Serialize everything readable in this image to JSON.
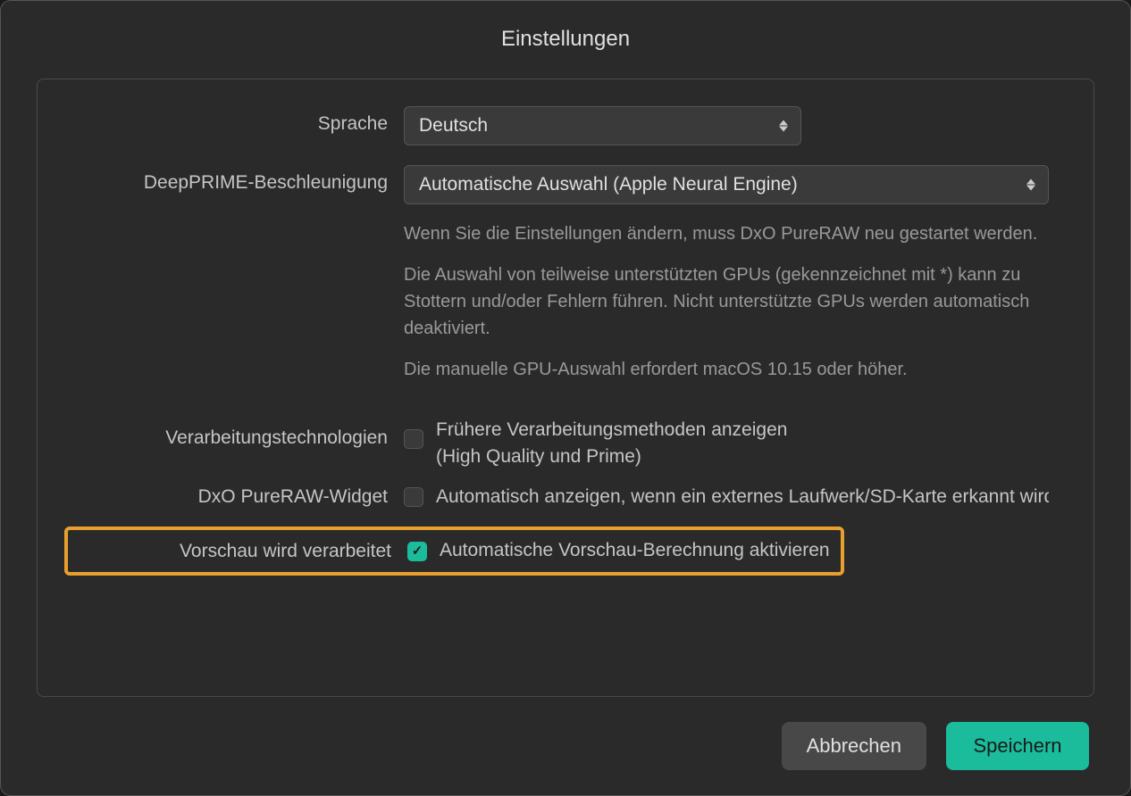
{
  "title": "Einstellungen",
  "language": {
    "label": "Sprache",
    "value": "Deutsch"
  },
  "acceleration": {
    "label": "DeepPRIME-Beschleunigung",
    "value": "Automatische Auswahl (Apple Neural Engine)",
    "help1": "Wenn Sie die Einstellungen ändern, muss DxO PureRAW neu gestartet werden.",
    "help2": "Die Auswahl von teilweise unterstützten GPUs (gekennzeichnet mit *) kann zu Stottern und/oder Fehlern führen. Nicht unterstützte GPUs werden automatisch deaktiviert.",
    "help3": "Die manuelle GPU-Auswahl erfordert macOS 10.15 oder höher."
  },
  "processing_tech": {
    "label": "Verarbeitungstechnologien",
    "checkbox_label": "Frühere Verarbeitungsmethoden anzeigen\n(High Quality und Prime)",
    "line1": "Frühere Verarbeitungsmethoden anzeigen",
    "line2": "(High Quality und Prime)"
  },
  "widget": {
    "label": "DxO PureRAW-Widget",
    "checkbox_label": "Automatisch anzeigen, wenn ein externes Laufwerk/SD-Karte erkannt wird"
  },
  "preview": {
    "label": "Vorschau wird verarbeitet",
    "checkbox_label": "Automatische Vorschau-Berechnung aktivieren"
  },
  "buttons": {
    "cancel": "Abbrechen",
    "save": "Speichern"
  }
}
